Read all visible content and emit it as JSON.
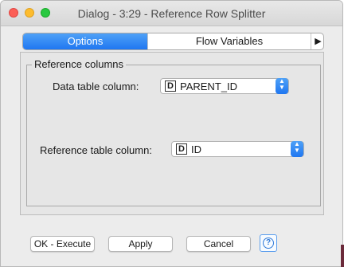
{
  "window": {
    "title": "Dialog - 3:29 - Reference Row Splitter"
  },
  "tabs": [
    {
      "label": "Options",
      "selected": true
    },
    {
      "label": "Flow Variables",
      "selected": false
    },
    {
      "label": "▶",
      "icon": "overflow-arrow-icon"
    }
  ],
  "group": {
    "legend": "Reference columns",
    "data_column": {
      "label": "Data table column:",
      "type_badge": "D",
      "value": "PARENT_ID"
    },
    "reference_column": {
      "label": "Reference table column:",
      "type_badge": "D",
      "value": "ID"
    }
  },
  "buttons": {
    "ok": "OK - Execute",
    "apply": "Apply",
    "cancel": "Cancel",
    "help": "?"
  },
  "colors": {
    "accent": "#1f77f1",
    "close": "#fc5f57",
    "minimize": "#fdbc2e",
    "maximize": "#28c840"
  }
}
